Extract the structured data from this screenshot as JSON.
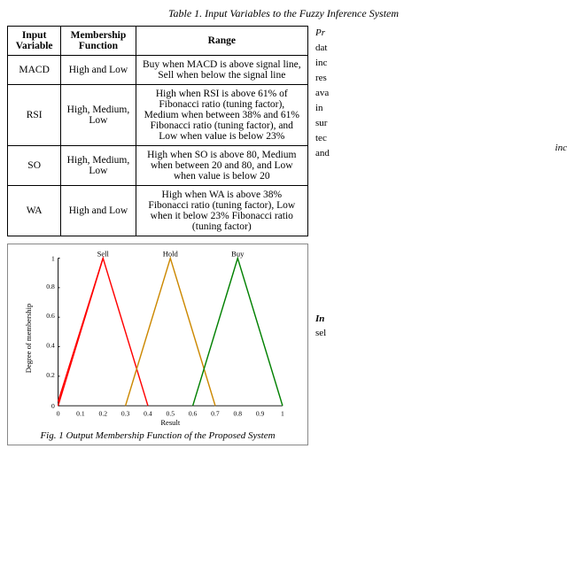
{
  "page": {
    "table_title": "Table 1. Input Variables to the Fuzzy Inference System",
    "table": {
      "headers": [
        "Input Variable",
        "Membership Function",
        "Range"
      ],
      "rows": [
        {
          "variable": "MACD",
          "membership": "High and Low",
          "range": "Buy when MACD is above signal line, Sell when below the signal line"
        },
        {
          "variable": "RSI",
          "membership": "High, Medium, Low",
          "range": "High when RSI is above 61% of Fibonacci ratio (tuning factor), Medium when between 38% and 61% Fibonacci ratio (tuning factor), and Low when value is below 23%"
        },
        {
          "variable": "SO",
          "membership": "High, Medium, Low",
          "range": "High when SO is above 80, Medium when between 20 and 80, and Low when value is below 20"
        },
        {
          "variable": "WA",
          "membership": "High and Low",
          "range": "High when WA is above 38% Fibonacci ratio (tuning factor), Low when it below 23% Fibonacci ratio (tuning factor)"
        }
      ]
    },
    "right_top_text": "Pr data inc res ava in su tec an",
    "chart": {
      "caption": "Fig. 1 Output Membership Function of the Proposed System",
      "labels": {
        "sell": "Sell",
        "hold": "Hold",
        "buy": "Buy"
      },
      "y_axis_label": "Degree of membership",
      "x_axis_label": "Result",
      "x_ticks": [
        "0",
        "0.1",
        "0.2",
        "0.3",
        "0.4",
        "0.5",
        "0.6",
        "0.7",
        "0.8",
        "0.9",
        "1"
      ],
      "y_ticks": [
        "0",
        "0.2",
        "0.4",
        "0.6",
        "0.8",
        "1"
      ]
    },
    "right_bottom": {
      "label": "In",
      "text": "sel"
    },
    "corner_text": "inc"
  }
}
